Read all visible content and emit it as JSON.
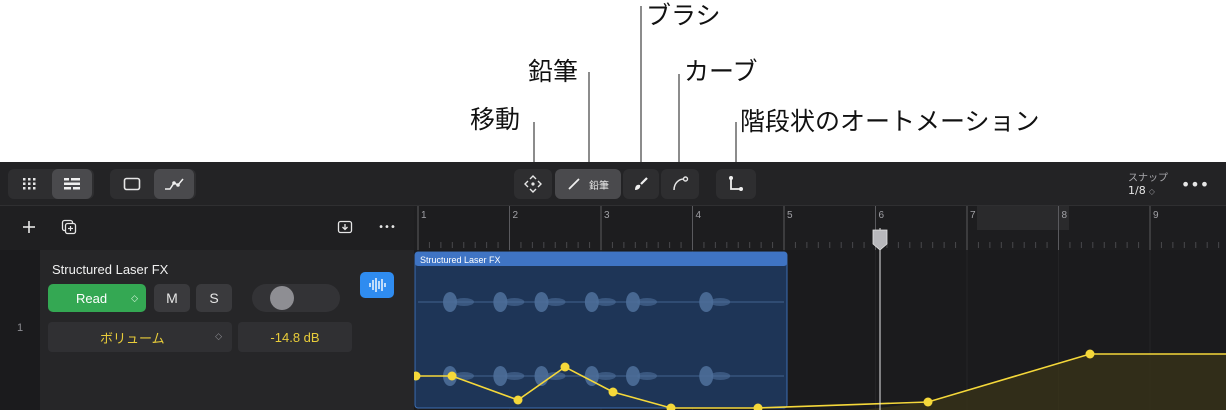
{
  "callouts": {
    "move": "移動",
    "pencil": "鉛筆",
    "brush": "ブラシ",
    "curve": "カーブ",
    "stepped": "階段状のオートメーション"
  },
  "toolbar": {
    "pencil_label": "鉛筆",
    "snap_label": "スナップ",
    "snap_value": "1/8",
    "more_icon": "ellipsis-icon"
  },
  "track_header": {
    "more_icon": "ellipsis-icon"
  },
  "track": {
    "number": "1",
    "name": "Structured Laser FX",
    "automation_mode": "Read",
    "mute_label": "M",
    "solo_label": "S",
    "parameter": "ボリューム",
    "value": "-14.8 dB"
  },
  "ruler": {
    "bars": [
      "1",
      "2",
      "3",
      "4",
      "5",
      "6",
      "7",
      "8",
      "9"
    ]
  },
  "region": {
    "name": "Structured Laser FX"
  },
  "automation": {
    "points": [
      [
        0,
        0.72
      ],
      [
        0.35,
        0.72
      ],
      [
        0.95,
        0.46
      ],
      [
        1.45,
        0.89
      ],
      [
        1.95,
        0.56
      ],
      [
        2.45,
        0.24
      ],
      [
        2.95,
        0.08
      ],
      [
        3.55,
        -0.88
      ]
    ]
  },
  "colors": {
    "region": "#2c5fa8",
    "automation": "#f5d83a",
    "read": "#34a853",
    "accent": "#2f8cf0"
  }
}
